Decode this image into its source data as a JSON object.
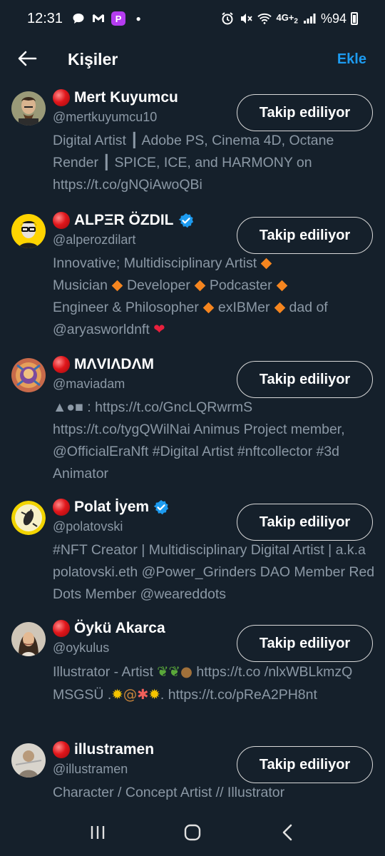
{
  "status_bar": {
    "time": "12:31",
    "battery_text": "%94",
    "network_text": "4G+",
    "sim_text": "2",
    "left_icons": [
      "chat-bubble-icon",
      "gmail-icon",
      "picsart-icon",
      "dot-icon"
    ],
    "right_icons": [
      "alarm-icon",
      "mute-icon",
      "wifi-icon",
      "signal-icon",
      "battery-icon"
    ]
  },
  "header": {
    "title": "Kişiler",
    "action": "Ekle"
  },
  "colors": {
    "background": "#15202b",
    "accent": "#1d9bf0",
    "secondary_text": "#8b98a5"
  },
  "people": [
    {
      "name": "Mert Kuyumcu",
      "handle": "@mertkuyumcu10",
      "verified": false,
      "bio": "Digital Artist ┃ Adobe PS, Cinema 4D, Octane Render ┃ SPICE, ICE, and HARMONY on https://t.co/gNQiAwoQBi",
      "follow_label": "Takip ediliyor"
    },
    {
      "name": "ALPΞR ÖZDIL",
      "handle": "@alperozdilart",
      "verified": true,
      "bio_parts": [
        "Innovative; Multidisciplinary Artist",
        "Musician",
        "Developer",
        "Podcaster",
        "Engineer & Philosopher",
        "exIBMer",
        "dad of @aryasworldnft"
      ],
      "follow_label": "Takip ediliyor"
    },
    {
      "name": "MΛVIΛDΛM",
      "handle": "@maviadam",
      "verified": false,
      "bio": "▲●■ : https://t.co/GncLQRwrmS https://t.co/tygQWilNai Animus Project member, @OfficialEraNft #Digital Artist #nftcollector  #3d Animator",
      "follow_label": "Takip ediliyor"
    },
    {
      "name": "Polat İyem",
      "handle": "@polatovski",
      "verified": true,
      "bio": "#NFT Creator | Multidisciplinary Digital Artist | a.k.a polatovski.eth  @Power_Grinders DAO Member   Red Dots Member @weareddots",
      "follow_label": "Takip ediliyor"
    },
    {
      "name": "Öykü Akarca",
      "handle": "@oykulus",
      "verified": false,
      "bio_parts": [
        "Illustrator - Artist",
        "https://t.co /nlxWBLkmzQ MSGSÜ .",
        ". https://t.co/pReA2PH8nt"
      ],
      "follow_label": "Takip ediliyor"
    },
    {
      "name": "illustramen",
      "handle": "@illustramen",
      "verified": false,
      "bio": "Character / Concept Artist // Illustrator",
      "follow_label": "Takip ediliyor"
    }
  ],
  "nav": [
    "recent-apps-icon",
    "home-icon",
    "back-icon"
  ]
}
